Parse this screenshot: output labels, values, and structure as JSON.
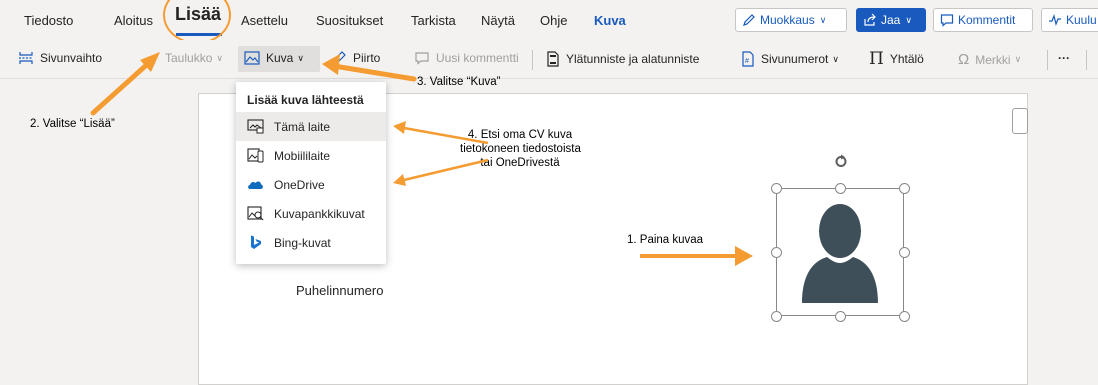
{
  "tabs": [
    {
      "label": "Tiedosto"
    },
    {
      "label": "Aloitus"
    },
    {
      "label": "Lisää"
    },
    {
      "label": "Asettelu"
    },
    {
      "label": "Suositukset"
    },
    {
      "label": "Tarkista"
    },
    {
      "label": "Näytä"
    },
    {
      "label": "Ohje"
    },
    {
      "label": "Kuva"
    }
  ],
  "top_buttons": {
    "edit": "Muokkaus",
    "share": "Jaa",
    "comments": "Kommentit",
    "partial": "Kuulu"
  },
  "commands": {
    "page_break": "Sivunvaihto",
    "table": "Taulukko",
    "picture": "Kuva",
    "drawing": "Piirto",
    "new_comment": "Uusi kommentti",
    "header_footer": "Ylätunniste ja alatunniste",
    "page_numbers": "Sivunumerot",
    "equation": "Yhtälö",
    "symbol": "Merkki",
    "more": "···"
  },
  "dropdown": {
    "header": "Lisää kuva lähteestä",
    "items": [
      {
        "label": "Tämä laite",
        "icon": "this-device-icon"
      },
      {
        "label": "Mobiililaite",
        "icon": "mobile-device-icon"
      },
      {
        "label": "OneDrive",
        "icon": "onedrive-icon"
      },
      {
        "label": "Kuvapankkikuvat",
        "icon": "stock-images-icon"
      },
      {
        "label": "Bing-kuvat",
        "icon": "bing-icon"
      }
    ]
  },
  "document": {
    "phone_label": "Puhelinnumero"
  },
  "annotations": {
    "step1": "1. Paina kuvaa",
    "step2": "2. Valitse “Lisää”",
    "step3": "3. Valitse “Kuva”",
    "step4_line1": "4. Etsi oma CV kuva",
    "step4_line2": "tietokoneen tiedostoista",
    "step4_line3": "tai  OneDrivestä"
  },
  "colors": {
    "accent": "#185abd",
    "annotation_arrow": "#f49c31",
    "avatar": "#3e4f5a",
    "onedrive": "#0f6cbd",
    "bing": "#1b75d0"
  }
}
